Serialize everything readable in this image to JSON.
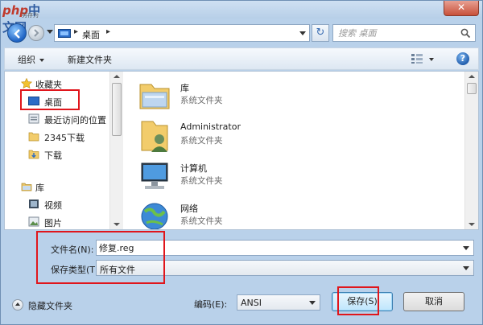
{
  "titlebar": {
    "logo_main_a": "php",
    "logo_main_b": "中文网",
    "logo_sub": "另存为",
    "close_label": "✕"
  },
  "address": {
    "location": "桌面",
    "search_placeholder": "搜索 桌面",
    "refresh_glyph": "↻"
  },
  "toolbar": {
    "organize_label": "组织",
    "new_folder_label": "新建文件夹",
    "help_label": "?"
  },
  "nav": {
    "favorites_label": "收藏夹",
    "desktop_label": "桌面",
    "recent_label": "最近访问的位置",
    "downloads2345_label": "2345下载",
    "downloads_label": "下载",
    "libraries_label": "库",
    "videos_label": "视频",
    "pictures_label": "图片"
  },
  "files": [
    {
      "name": "库",
      "type": "系统文件夹"
    },
    {
      "name": "Administrator",
      "type": "系统文件夹"
    },
    {
      "name": "计算机",
      "type": "系统文件夹"
    },
    {
      "name": "网络",
      "type": "系统文件夹"
    }
  ],
  "form": {
    "filename_label": "文件名(N):",
    "filename_value": "修复.reg",
    "filetype_label": "保存类型(T):",
    "filetype_value": "所有文件"
  },
  "footer": {
    "hide_folders_label": "隐藏文件夹",
    "encoding_label": "编码(E):",
    "encoding_value": "ANSI",
    "save_label": "保存(S)",
    "cancel_label": "取消"
  },
  "colors": {
    "highlight": "#e0161c",
    "chrome": "#b9d1ea",
    "accent": "#1e63c4"
  }
}
